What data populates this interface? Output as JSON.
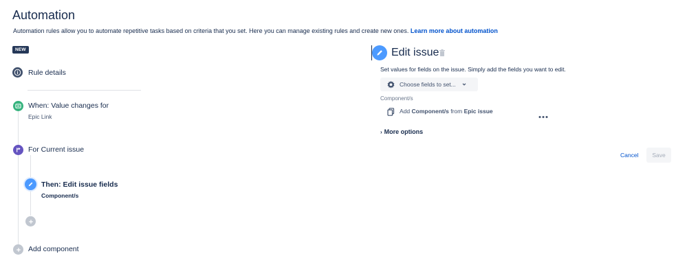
{
  "page": {
    "title": "Automation",
    "description": "Automation rules allow you to automate repetitive tasks based on criteria that you set. Here you can manage existing rules and create new ones.",
    "learn_more": "Learn more about automation",
    "new_badge": "NEW"
  },
  "rule": {
    "details_label": "Rule details",
    "trigger_label": "When: Value changes for",
    "trigger_value": "Epic Link",
    "branch_label": "For Current issue",
    "action_label": "Then: Edit issue fields",
    "action_value": "Component/s",
    "add_component_label": "Add component"
  },
  "panel": {
    "title": "Edit issue",
    "description": "Set values for fields on the issue. Simply add the fields you want to edit.",
    "choose_fields": "Choose fields to set...",
    "field_label": "Component/s",
    "field_row_prefix": "Add",
    "field_row_bold1": "Component/s",
    "field_row_mid": "from",
    "field_row_bold2": "Epic issue",
    "more_options": "More options",
    "cancel": "Cancel",
    "save": "Save"
  },
  "icons": {
    "info": "info-icon",
    "trigger": "trigger-icon",
    "branch": "branch-icon",
    "pencil": "pencil-icon",
    "plus": "plus-icon",
    "trash": "trash-icon",
    "gear": "gear-icon",
    "copy": "copy-icon",
    "more": "more-icon"
  },
  "colors": {
    "info_circle": "#42526e",
    "trigger_circle": "#36b37e",
    "branch_circle": "#6554c0",
    "action_circle": "#4c9aff",
    "add_circle": "#c1c7d0",
    "link": "#0052cc"
  }
}
